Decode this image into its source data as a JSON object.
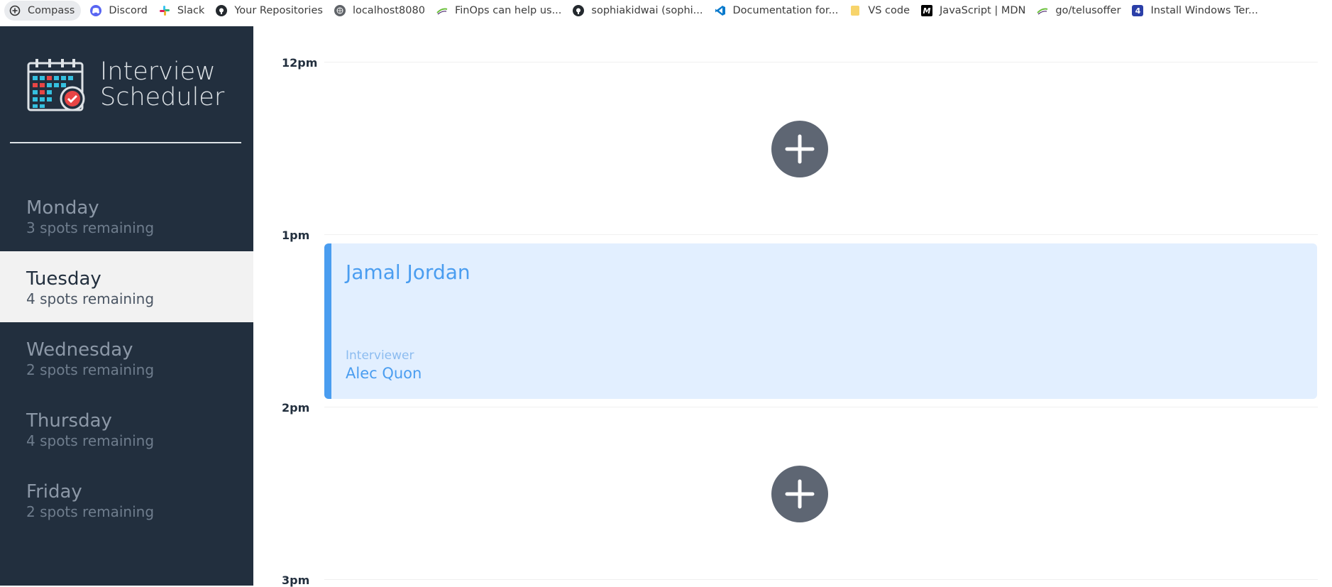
{
  "bookmarks": [
    {
      "label": "Compass",
      "icon": "compass-icon"
    },
    {
      "label": "Discord",
      "icon": "discord-icon"
    },
    {
      "label": "Slack",
      "icon": "slack-icon"
    },
    {
      "label": "Your Repositories",
      "icon": "github-icon"
    },
    {
      "label": "localhost8080",
      "icon": "globe-icon"
    },
    {
      "label": "FinOps can help us...",
      "icon": "finops-icon"
    },
    {
      "label": "sophiakidwai (sophi...",
      "icon": "github-icon"
    },
    {
      "label": "Documentation for...",
      "icon": "vscode-icon"
    },
    {
      "label": "VS code",
      "icon": "folder-icon"
    },
    {
      "label": "JavaScript | MDN",
      "icon": "mdn-icon"
    },
    {
      "label": "go/telusoffer",
      "icon": "telus-icon"
    },
    {
      "label": "Install Windows Ter...",
      "icon": "windows-terminal-icon"
    }
  ],
  "app": {
    "title_line1": "Interview",
    "title_line2": "Scheduler"
  },
  "days": [
    {
      "name": "Monday",
      "spots": "3 spots remaining",
      "selected": false
    },
    {
      "name": "Tuesday",
      "spots": "4 spots remaining",
      "selected": true
    },
    {
      "name": "Wednesday",
      "spots": "2 spots remaining",
      "selected": false
    },
    {
      "name": "Thursday",
      "spots": "4 spots remaining",
      "selected": false
    },
    {
      "name": "Friday",
      "spots": "2 spots remaining",
      "selected": false
    }
  ],
  "schedule": {
    "times": [
      "12pm",
      "1pm",
      "2pm",
      "3pm"
    ],
    "appointment": {
      "student": "Jamal Jordan",
      "interviewer_label": "Interviewer",
      "interviewer": "Alec Quon"
    }
  },
  "colors": {
    "sidebar": "#222f3e",
    "selected_day_bg": "#f2f2f2",
    "appointment_bg": "#e2efff",
    "appointment_accent": "#4a9df0",
    "add_button": "#5e6673"
  }
}
